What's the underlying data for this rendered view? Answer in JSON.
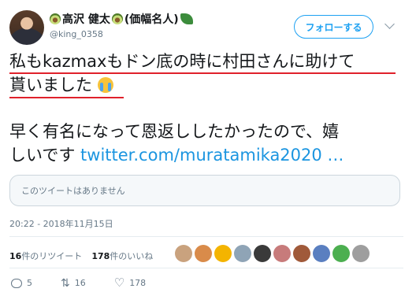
{
  "author": {
    "name": "高沢 健太",
    "name_suffix": "(価幅名人)",
    "handle": "@king_0358"
  },
  "follow_button": {
    "label": "フォローする"
  },
  "tweet": {
    "line1": "私もkazmaxもドン底の時に村田さんに助けて",
    "line2": "貰いました",
    "line3": "早く有名になって恩返ししたかったので、嬉",
    "line4_text": "しいです ",
    "line4_link": "twitter.com/muratamika2020 …"
  },
  "quote": {
    "text": "このツイートはありません"
  },
  "timestamp": "20:22 - 2018年11月15日",
  "stats": {
    "retweets_count": "16",
    "retweets_label": "件のリツイート",
    "likes_count": "178",
    "likes_label": "件のいいね"
  },
  "likers_colors": [
    "#c9a27e",
    "#d98b4a",
    "#f4b400",
    "#8fa4b6",
    "#3a3a3a",
    "#c77b7b",
    "#a05a3a",
    "#5a7fc0",
    "#4caf50",
    "#9e9e9e"
  ],
  "actions": {
    "reply_count": "5",
    "retweet_count": "16",
    "like_count": "178"
  },
  "colors": {
    "accent": "#1da1f2",
    "underline": "#e0212b"
  }
}
